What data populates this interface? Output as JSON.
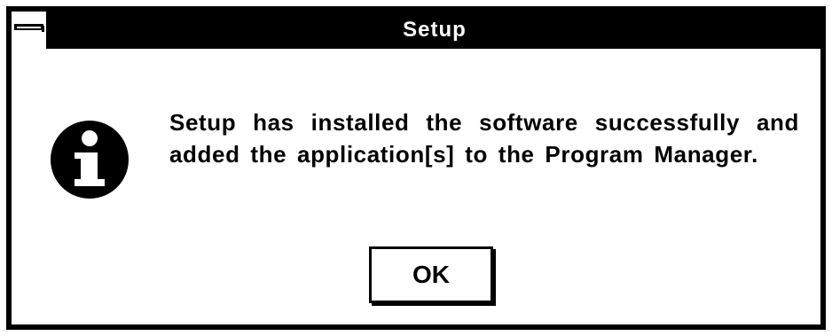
{
  "window": {
    "title": "Setup",
    "system_menu_icon": "system-menu-icon"
  },
  "dialog": {
    "icon": "info-icon",
    "message": "Setup has installed the software successfully and added the application[s] to the Program Manager."
  },
  "buttons": {
    "ok_label": "OK"
  },
  "colors": {
    "title_bar": "#000000",
    "title_text": "#ffffff",
    "background": "#ffffff",
    "border": "#000000"
  }
}
